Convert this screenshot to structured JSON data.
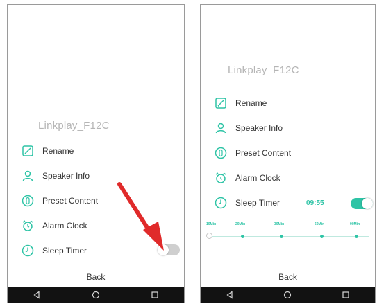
{
  "left_screen": {
    "device_name": "Linkplay_F12C",
    "menu": [
      {
        "label": "Rename",
        "icon": "rename-icon"
      },
      {
        "label": "Speaker Info",
        "icon": "person-icon"
      },
      {
        "label": "Preset Content",
        "icon": "preset-icon"
      },
      {
        "label": "Alarm Clock",
        "icon": "alarm-clock-icon"
      },
      {
        "label": "Sleep Timer",
        "icon": "clock-icon"
      }
    ],
    "sleep_timer_toggle": "off",
    "back_label": "Back",
    "annotation_arrow_color": "#e02a2a"
  },
  "right_screen": {
    "device_name": "Linkplay_F12C",
    "menu": [
      {
        "label": "Rename",
        "icon": "rename-icon"
      },
      {
        "label": "Speaker Info",
        "icon": "person-icon"
      },
      {
        "label": "Preset Content",
        "icon": "preset-icon"
      },
      {
        "label": "Alarm Clock",
        "icon": "alarm-clock-icon"
      },
      {
        "label": "Sleep Timer",
        "icon": "clock-icon"
      }
    ],
    "sleep_timer_value": "09:55",
    "sleep_timer_toggle": "on",
    "timer_options": [
      "10Min",
      "20Min",
      "30Min",
      "60Min",
      "90Min"
    ],
    "back_label": "Back"
  },
  "colors": {
    "accent": "#2ec4a6",
    "toggle_off": "#cfcfcf",
    "nav_bar": "#121212",
    "device_name": "#b5b5b5"
  },
  "nav_icons": [
    "back-triangle-icon",
    "home-circle-icon",
    "recent-square-icon"
  ]
}
